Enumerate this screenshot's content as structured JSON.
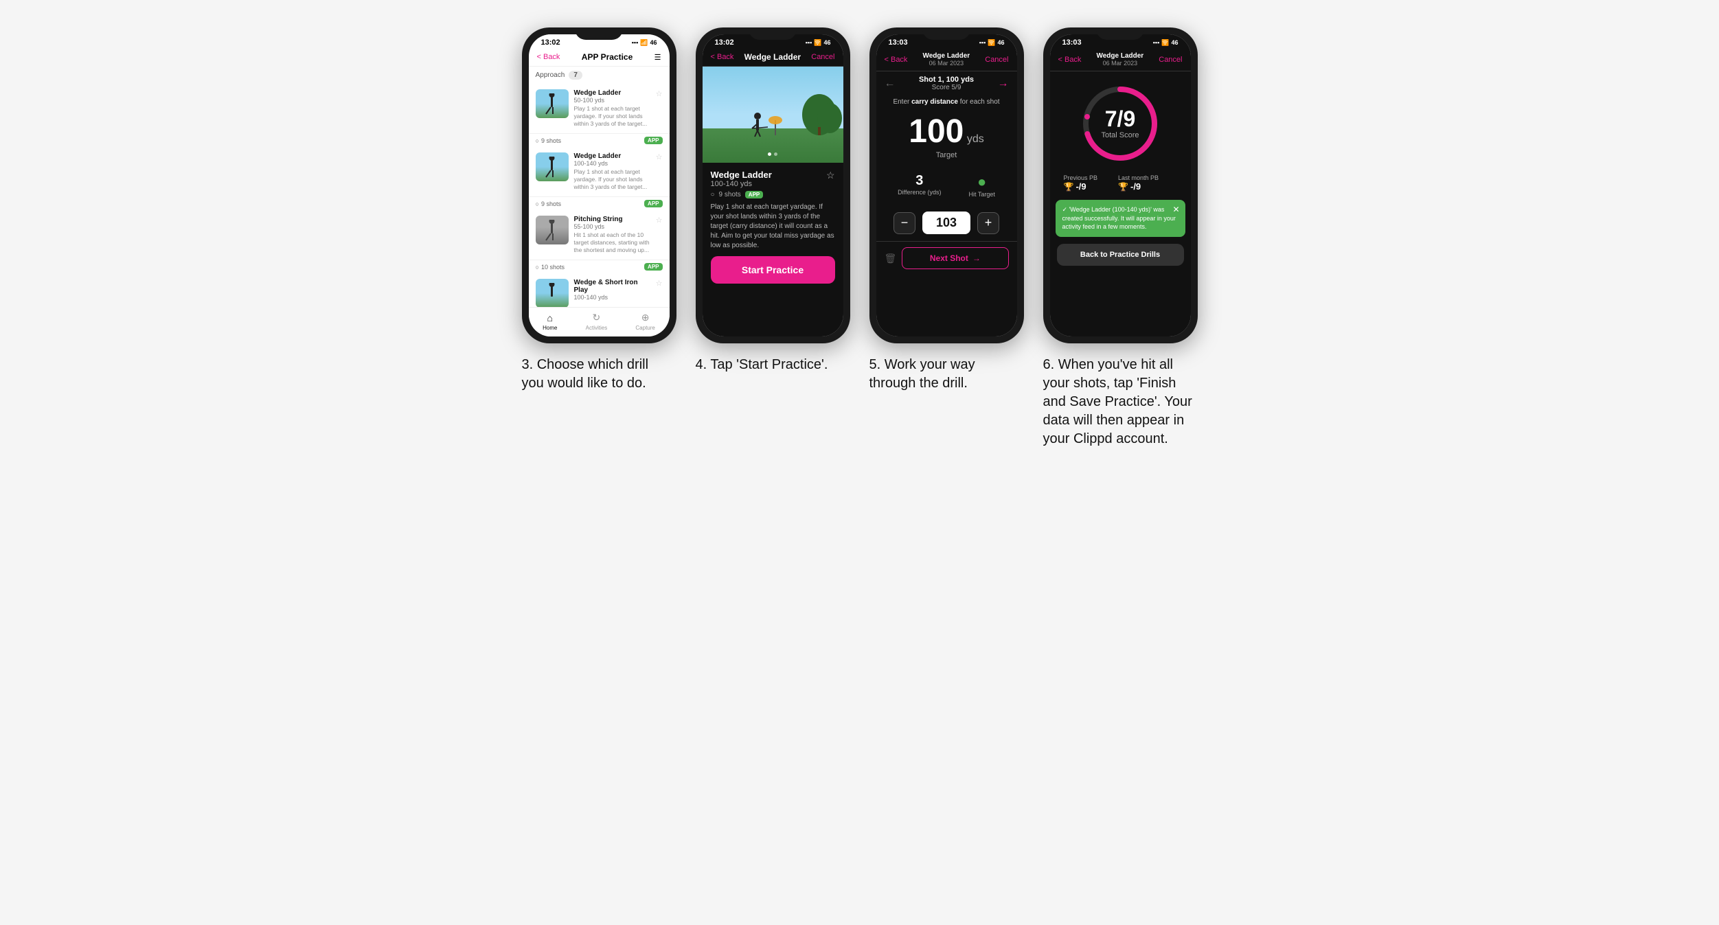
{
  "phones": [
    {
      "id": "phone3",
      "statusTime": "13:02",
      "navBack": "< Back",
      "navTitle": "APP Practice",
      "navMenuIcon": "☰",
      "approachLabel": "Approach",
      "approachCount": "7",
      "drills": [
        {
          "name": "Wedge Ladder",
          "yds": "50-100 yds",
          "desc": "Play 1 shot at each target yardage. If your shot lands within 3 yards of the target...",
          "shots": "9 shots",
          "badge": "APP"
        },
        {
          "name": "Wedge Ladder",
          "yds": "100-140 yds",
          "desc": "Play 1 shot at each target yardage. If your shot lands within 3 yards of the target...",
          "shots": "9 shots",
          "badge": "APP"
        },
        {
          "name": "Pitching String",
          "yds": "55-100 yds",
          "desc": "Hit 1 shot at each of the 10 target distances, starting with the shortest and moving up...",
          "shots": "10 shots",
          "badge": "APP"
        },
        {
          "name": "Wedge & Short Iron Play",
          "yds": "100-140 yds",
          "desc": "",
          "shots": "",
          "badge": ""
        }
      ],
      "tabs": [
        {
          "label": "Home",
          "icon": "⌂",
          "active": true
        },
        {
          "label": "Activities",
          "icon": "♻",
          "active": false
        },
        {
          "label": "Capture",
          "icon": "⊕",
          "active": false
        }
      ]
    },
    {
      "id": "phone4",
      "statusTime": "13:02",
      "navBack": "< Back",
      "navTitle": "Wedge Ladder",
      "navCancel": "Cancel",
      "drillName": "Wedge Ladder",
      "drillYds": "100-140 yds",
      "shotsCount": "9 shots",
      "badge": "APP",
      "desc": "Play 1 shot at each target yardage. If your shot lands within 3 yards of the target (carry distance) it will count as a hit. Aim to get your total miss yardage as low as possible.",
      "startBtn": "Start Practice"
    },
    {
      "id": "phone5",
      "statusTime": "13:03",
      "navBack": "< Back",
      "navTitle": "Wedge Ladder",
      "navSubtitle": "06 Mar 2023",
      "navCancel": "Cancel",
      "shotLabel": "Shot 1, 100 yds",
      "scoreLabel": "Score 5/9",
      "carryInstruction": "Enter carry distance for each shot",
      "targetNumber": "100",
      "targetUnit": "yds",
      "targetLabel": "Target",
      "difference": "3",
      "differenceLabel": "Difference (yds)",
      "hitTarget": "●",
      "hitTargetLabel": "Hit Target",
      "inputValue": "103",
      "nextShot": "Next Shot",
      "nextArrow": "→"
    },
    {
      "id": "phone6",
      "statusTime": "13:03",
      "navBack": "< Back",
      "navTitle": "Wedge Ladder",
      "navSubtitle": "06 Mar 2023",
      "navCancel": "Cancel",
      "scoreNumerator": "7",
      "scoreDenominator": "/9",
      "scoreTotalLabel": "Total Score",
      "previousPBLabel": "Previous PB",
      "previousPBValue": "-/9",
      "lastMonthPBLabel": "Last month PB",
      "lastMonthPBValue": "-/9",
      "toastText": "'Wedge Ladder (100-140 yds)' was created successfully. It will appear in your activity feed in a few moments.",
      "backBtn": "Back to Practice Drills"
    }
  ],
  "captions": [
    "3. Choose which drill you would like to do.",
    "4. Tap 'Start Practice'.",
    "5. Work your way through the drill.",
    "6. When you've hit all your shots, tap 'Finish and Save Practice'. Your data will then appear in your Clippd account."
  ]
}
